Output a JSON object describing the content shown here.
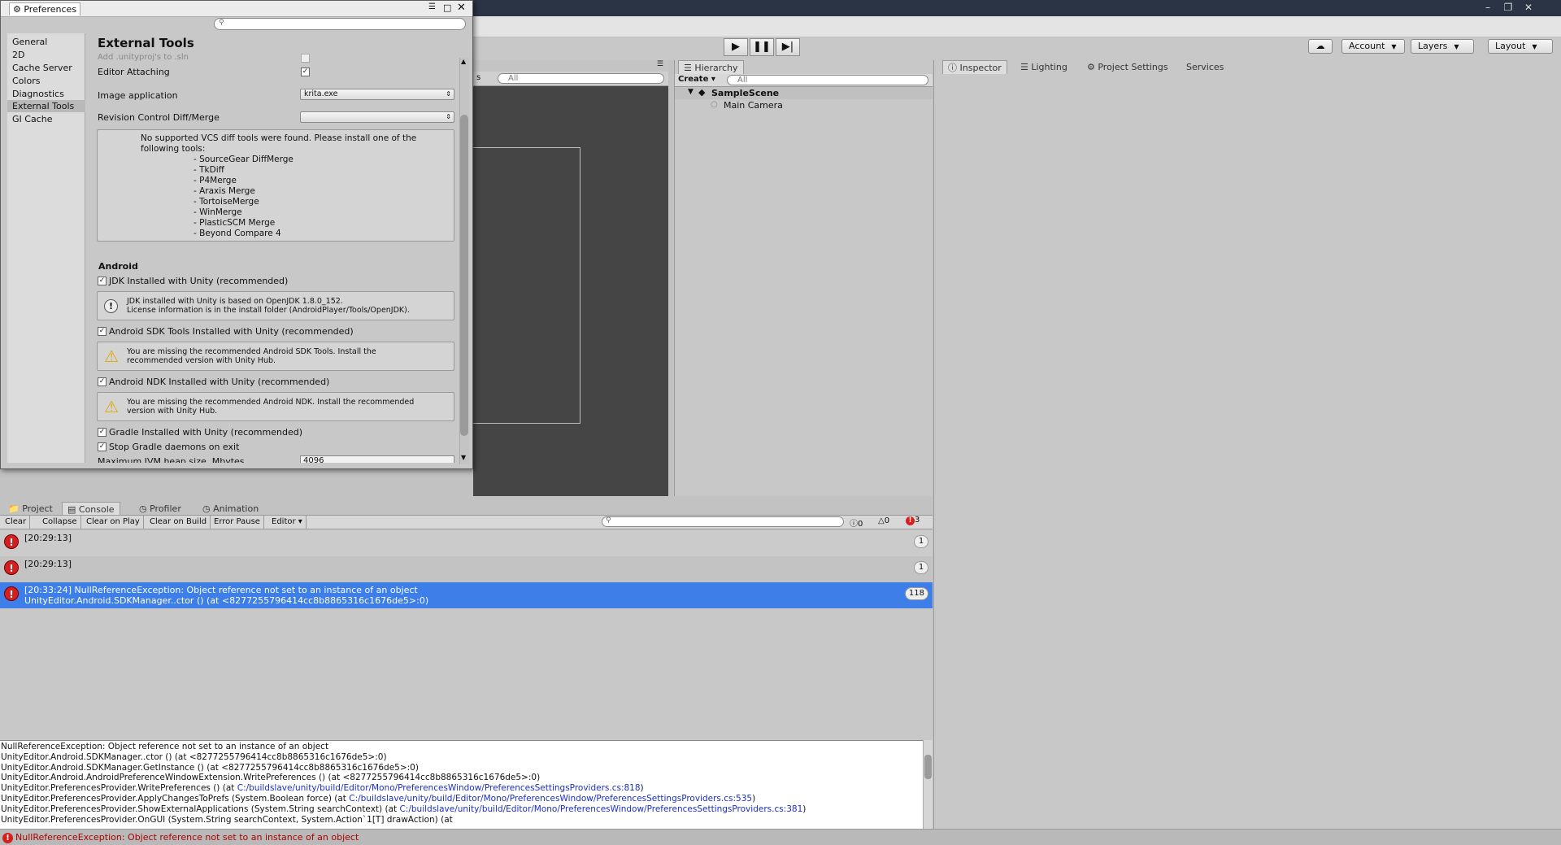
{
  "toolbar": {
    "account": "Account",
    "layers": "Layers",
    "layout": "Layout",
    "play_icon": "play-icon",
    "pause_icon": "pause-icon",
    "step_icon": "step-icon"
  },
  "scene": {
    "search_placeholder": "All",
    "options_label": "s"
  },
  "hierarchy": {
    "tab": "Hierarchy",
    "create": "Create",
    "search_placeholder": "All",
    "scene_name": "SampleScene",
    "items": [
      "Main Camera"
    ]
  },
  "inspector": {
    "tabs": [
      "Inspector",
      "Lighting",
      "Project Settings",
      "Services"
    ]
  },
  "preferences": {
    "title": "Preferences",
    "nav": [
      "General",
      "2D",
      "Cache Server",
      "Colors",
      "Diagnostics",
      "External Tools",
      "GI Cache"
    ],
    "selected": "External Tools",
    "heading": "External Tools",
    "add_unityproj": "Add .unityproj's to .sln",
    "editor_attaching": "Editor Attaching",
    "image_app_label": "Image application",
    "image_app_value": "krita.exe",
    "revision_label": "Revision Control Diff/Merge",
    "revision_value": "",
    "vcs_line1": "No supported VCS diff tools were found. Please install one of the",
    "vcs_line2": "following tools:",
    "vcs_tools": [
      "- SourceGear DiffMerge",
      "- TkDiff",
      "- P4Merge",
      "- Araxis Merge",
      "- TortoiseMerge",
      "- WinMerge",
      "- PlasticSCM Merge",
      "- Beyond Compare 4"
    ],
    "android_heading": "Android",
    "jdk_label": "JDK Installed with Unity (recommended)",
    "jdk_info1": "JDK installed with Unity is based on OpenJDK 1.8.0_152.",
    "jdk_info2": "License information is in the install folder (AndroidPlayer/Tools/OpenJDK).",
    "sdk_label": "Android SDK Tools Installed with Unity (recommended)",
    "sdk_warn1": "You are missing the recommended Android SDK Tools. Install the",
    "sdk_warn2": "recommended version with Unity Hub.",
    "ndk_label": "Android NDK Installed with Unity (recommended)",
    "ndk_warn1": "You are missing the recommended Android NDK. Install the recommended",
    "ndk_warn2": "version with Unity Hub.",
    "gradle_label": "Gradle Installed with Unity (recommended)",
    "stop_gradle_label": "Stop Gradle daemons on exit",
    "jvm_label": "Maximum JVM heap size, Mbytes",
    "jvm_value": "4096"
  },
  "console": {
    "tabs": [
      "Project",
      "Console",
      "Profiler",
      "Animation"
    ],
    "buttons": [
      "Clear",
      "Collapse",
      "Clear on Play",
      "Clear on Build",
      "Error Pause",
      "Editor"
    ],
    "counts": {
      "info": "0",
      "warn": "0",
      "error": "3"
    },
    "rows": [
      {
        "line1": "[20:29:13]",
        "line2": "",
        "count": "1"
      },
      {
        "line1": "[20:29:13]",
        "line2": "",
        "count": "1"
      },
      {
        "line1": "[20:33:24] NullReferenceException: Object reference not set to an instance of an object",
        "line2": "UnityEditor.Android.SDKManager..ctor () (at <8277255796414cc8b8865316c1676de5>:0)",
        "count": "118"
      }
    ],
    "detail": {
      "l1": "NullReferenceException: Object reference not set to an instance of an object",
      "l2": "UnityEditor.Android.SDKManager..ctor () (at <8277255796414cc8b8865316c1676de5>:0)",
      "l3": "UnityEditor.Android.SDKManager.GetInstance () (at <8277255796414cc8b8865316c1676de5>:0)",
      "l4": "UnityEditor.Android.AndroidPreferenceWindowExtension.WritePreferences () (at <8277255796414cc8b8865316c1676de5>:0)",
      "l5a": "UnityEditor.PreferencesProvider.WritePreferences () (at ",
      "l5b": "C:/buildslave/unity/build/Editor/Mono/PreferencesWindow/PreferencesSettingsProviders.cs:818",
      "l5c": ")",
      "l6a": "UnityEditor.PreferencesProvider.ApplyChangesToPrefs (System.Boolean force) (at ",
      "l6b": "C:/buildslave/unity/build/Editor/Mono/PreferencesWindow/PreferencesSettingsProviders.cs:535",
      "l6c": ")",
      "l7a": "UnityEditor.PreferencesProvider.ShowExternalApplications (System.String searchContext) (at ",
      "l7b": "C:/buildslave/unity/build/Editor/Mono/PreferencesWindow/PreferencesSettingsProviders.cs:381",
      "l7c": ")",
      "l8": "UnityEditor.PreferencesProvider.OnGUI (System.String searchContext, System.Action`1[T] drawAction) (at"
    }
  },
  "status": {
    "message": "NullReferenceException: Object reference not set to an instance of an object"
  }
}
